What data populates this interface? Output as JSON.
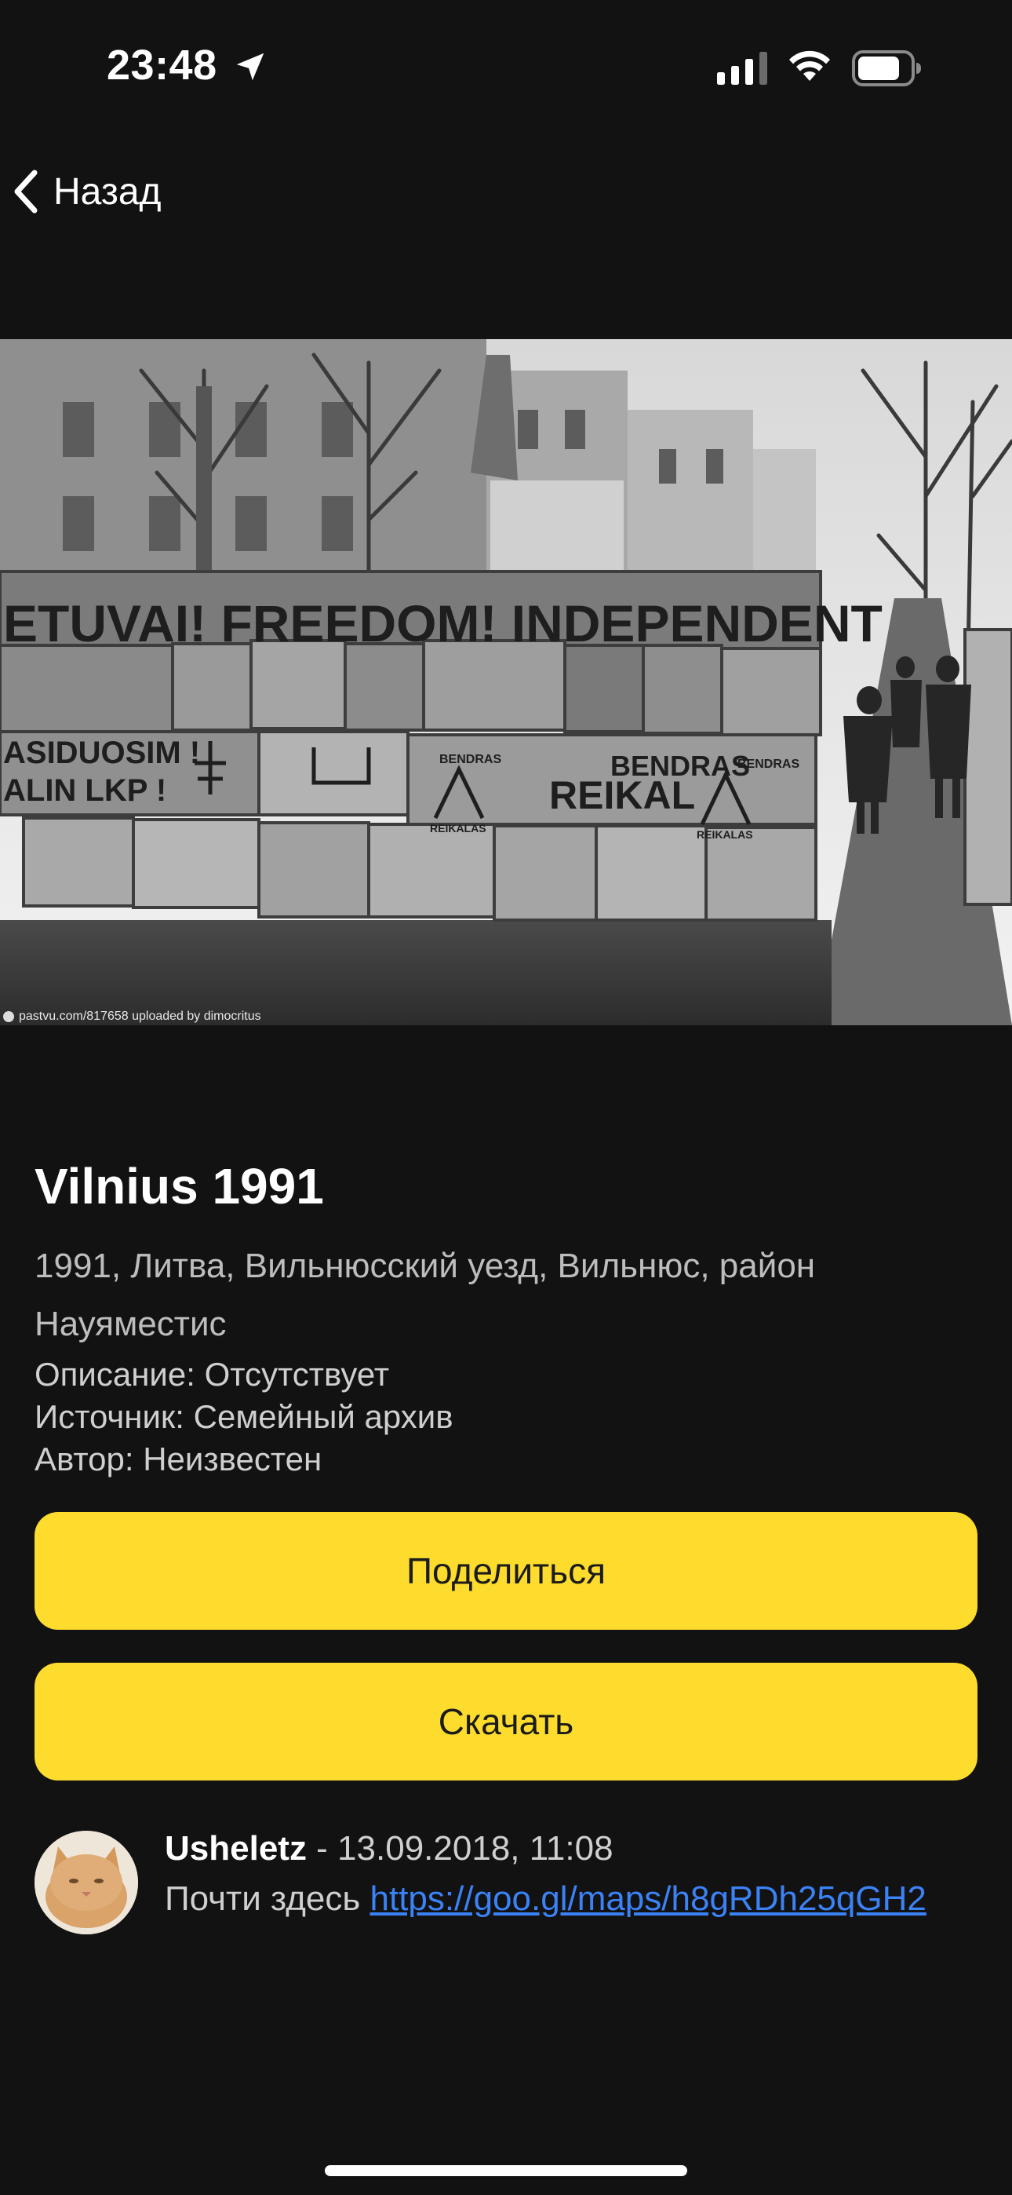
{
  "status_bar": {
    "time": "23:48",
    "icons": [
      "location-arrow-icon",
      "cellular-signal-icon",
      "wifi-icon",
      "battery-icon"
    ]
  },
  "nav": {
    "back_label": "Назад",
    "back_icon": "chevron-left-icon"
  },
  "photo": {
    "alt": "Vilnius 1991",
    "wall_texts": [
      "ETUVAI! FREEDOM! INDEPENDENT",
      "ASIDUOSIM !",
      "ALIN LKP !",
      "BENDRAS",
      "BENDRAS",
      "REIKAL",
      "REIKALAS",
      "REIKALAS",
      "BENDRAS"
    ],
    "watermark": "pastvu.com/817658  uploaded by dimocritus"
  },
  "details": {
    "title": "Vilnius 1991",
    "location": "1991, Литва, Вильнюсский уезд, Вильнюс, район Науяместис",
    "description": "Описание: Отсутствует",
    "source": "Источник: Семейный архив",
    "author": "Автор: Неизвестен"
  },
  "actions": {
    "share_label": "Поделиться",
    "download_label": "Скачать",
    "button_color": "#fedc2d"
  },
  "comment": {
    "username": "Usheletz",
    "datetime": " - 13.09.2018, 11:08",
    "text": "Почти здесь ",
    "link": "https://goo.gl/maps/h8gRDh25qGH2",
    "link_color": "#3b82f6"
  },
  "theme": {
    "background": "#121212",
    "text_primary": "#ffffff",
    "text_secondary": "#bdbdbd"
  }
}
